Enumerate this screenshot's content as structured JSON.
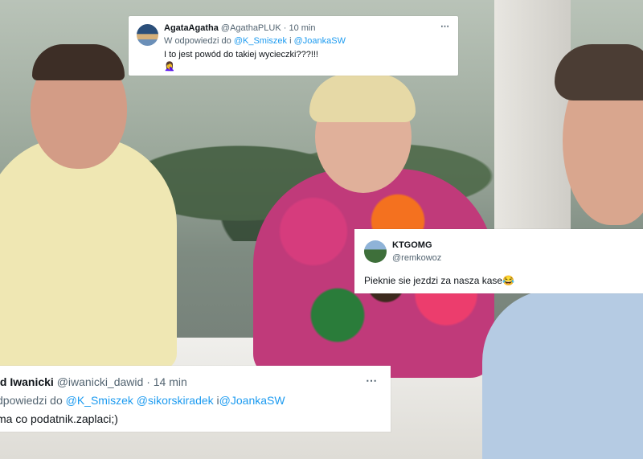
{
  "tweet_top": {
    "name": "AgataAgatha",
    "handle": "@AgathaPLUK",
    "time": "10 min",
    "reply_prefix": "W odpowiedzi do",
    "reply_mention_1": "@K_Smiszek",
    "reply_joiner": "i",
    "reply_mention_2": "@JoankaSW",
    "text": "I to jest powód do takiej wycieczki???!!!",
    "emoji": "🤦‍♀️",
    "more_icon": "⋯"
  },
  "tweet_right": {
    "name": "KTGOMG",
    "handle": "@remkowoz",
    "text": "Pieknie sie jezdzi za nasza kase😂"
  },
  "tweet_bottom": {
    "name": "id Iwanicki",
    "handle": "@iwanicki_dawid",
    "time": "14 min",
    "reply_prefix": "dpowiedzi do",
    "reply_mention_1": "@K_Smiszek",
    "reply_mention_2": "@sikorskiradek",
    "reply_joiner": "i",
    "reply_mention_3": "@JoankaSW",
    "text": "ma co podatnik.zaplaci;)",
    "more_icon": "⋯"
  },
  "colors": {
    "mention": "#1d9bf0",
    "secondary_text": "#536471",
    "primary_text": "#0f1419"
  }
}
